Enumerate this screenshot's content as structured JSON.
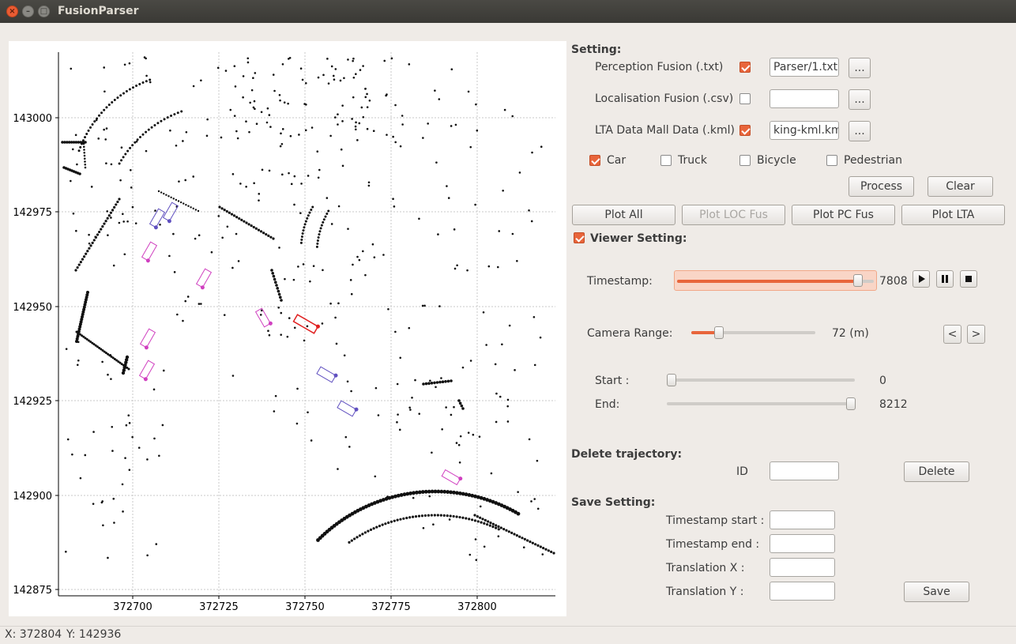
{
  "window": {
    "title": "FusionParser"
  },
  "plot": {
    "x_ticks": [
      "372700",
      "372725",
      "372750",
      "372775",
      "372800"
    ],
    "y_ticks": [
      "143000",
      "142975",
      "142950",
      "142925",
      "142900",
      "142875"
    ]
  },
  "settings": {
    "heading": "Setting:",
    "perception": {
      "label": "Perception Fusion (.txt)",
      "checked": true,
      "value": "Parser/1.txt",
      "browse": "..."
    },
    "localisation": {
      "label": "Localisation Fusion (.csv)",
      "checked": false,
      "value": "",
      "browse": "..."
    },
    "lta": {
      "label": "LTA Data Mall Data (.kml)",
      "checked": true,
      "value": "king-kml.kml",
      "browse": "..."
    },
    "types": [
      {
        "label": "Car",
        "checked": true
      },
      {
        "label": "Truck",
        "checked": false
      },
      {
        "label": "Bicycle",
        "checked": false
      },
      {
        "label": "Pedestrian",
        "checked": false
      }
    ],
    "process_label": "Process",
    "clear_label": "Clear"
  },
  "plot_buttons": {
    "all": "Plot All",
    "loc": "Plot LOC Fus",
    "pc": "Plot PC Fus",
    "lta": "Plot LTA"
  },
  "viewer": {
    "heading": "Viewer Setting:",
    "checked": true,
    "timestamp_label": "Timestamp:",
    "timestamp_value": "7808",
    "timestamp_fraction": 0.92,
    "camera_label": "Camera Range:",
    "camera_value": "72 (m)",
    "camera_fraction": 0.22,
    "prev_label": "<",
    "next_label": ">",
    "start_label": "Start :",
    "start_value": "0",
    "start_fraction": 0.0,
    "end_label": "End:",
    "end_value": "8212",
    "end_fraction": 0.98
  },
  "delete": {
    "heading": "Delete trajectory:",
    "id_label": "ID",
    "id_value": "",
    "button": "Delete"
  },
  "save": {
    "heading": "Save Setting:",
    "ts_start_label": "Timestamp start :",
    "ts_end_label": "Timestamp end :",
    "tx_label": "Translation X :",
    "ty_label": "Translation Y :",
    "ts_start_value": "",
    "ts_end_value": "",
    "tx_value": "",
    "ty_value": "",
    "button": "Save"
  },
  "status": {
    "x": "X: 372804",
    "y": "Y: 142936"
  },
  "colors": {
    "accent": "#e8653b",
    "selected_box": "#e02020",
    "box_magenta": "#d040c0",
    "box_blue": "#6050c0"
  }
}
